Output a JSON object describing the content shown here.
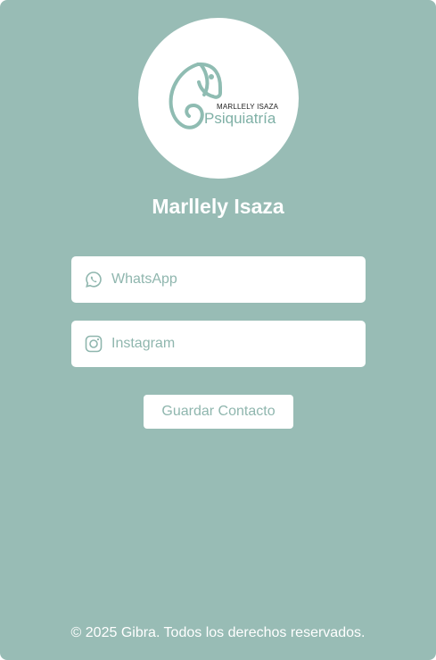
{
  "profile": {
    "logo_subtitle": "MARLLELY ISAZA",
    "logo_title": "Psiquiatría",
    "name": "Marllely Isaza"
  },
  "links": {
    "whatsapp": {
      "label": "WhatsApp",
      "icon": "whatsapp-icon"
    },
    "instagram": {
      "label": "Instagram",
      "icon": "instagram-icon"
    }
  },
  "actions": {
    "save_contact": "Guardar Contacto"
  },
  "footer": {
    "copyright": "© 2025 Gibra. Todos los derechos reservados."
  },
  "colors": {
    "background": "#98bcb5",
    "accent": "#8fb6ae",
    "card_white": "#ffffff"
  }
}
